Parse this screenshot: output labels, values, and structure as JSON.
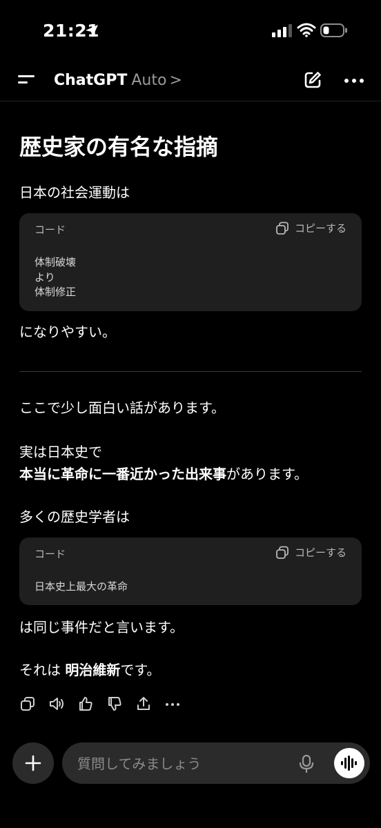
{
  "status": {
    "time": "21:21"
  },
  "nav": {
    "title": "ChatGPT",
    "model": "Auto",
    "chevron": ">"
  },
  "message": {
    "heading": "歴史家の有名な指摘",
    "p1": "日本の社会運動は",
    "code1": {
      "lang": "コード",
      "copy_label": "コピーする",
      "lines": [
        "体制破壊",
        "より",
        "体制修正"
      ]
    },
    "p2": "になりやすい。",
    "p3": "ここで少し面白い話があります。",
    "p4": "実は日本史で",
    "p5_bold": "本当に革命に一番近かった出来事",
    "p5_rest": "があります。",
    "p6": "多くの歴史学者は",
    "code2": {
      "lang": "コード",
      "copy_label": "コピーする",
      "lines": [
        "日本史上最大の革命"
      ]
    },
    "p7": "は同じ事件だと言います。",
    "p8_pre": "それは ",
    "p8_bold": "明治維新",
    "p8_rest": "です。"
  },
  "composer": {
    "placeholder": "質問してみましょう"
  },
  "icons": [
    "location-arrow-icon",
    "signal-icon",
    "wifi-icon",
    "battery-icon",
    "menu-icon",
    "compose-icon",
    "more-icon",
    "copy-icon",
    "speaker-icon",
    "thumbs-up-icon",
    "thumbs-down-icon",
    "share-icon",
    "plus-icon",
    "mic-icon",
    "voice-waveform-icon"
  ]
}
